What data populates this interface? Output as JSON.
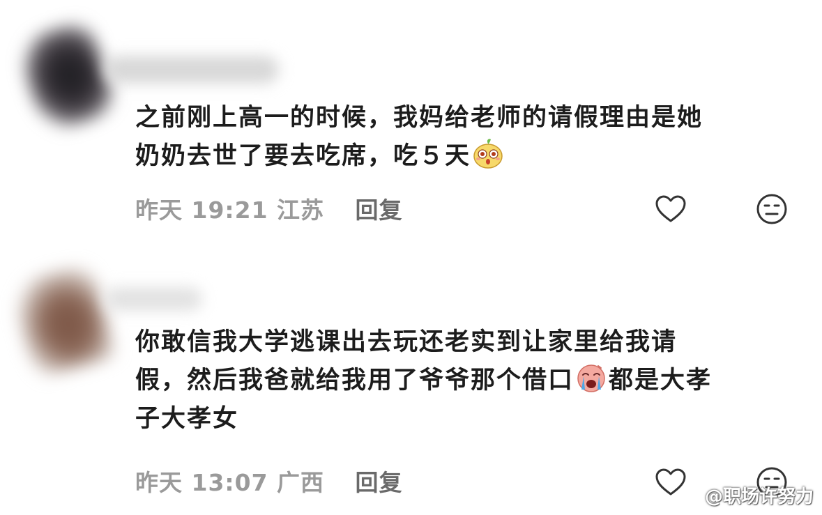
{
  "comments": [
    {
      "lines": [
        "之前刚上高一的时候，我妈给老师的请假理由是她",
        "奶奶去世了要去吃席，吃５天"
      ],
      "emoji": "shocked-fruit-emoji",
      "time": "昨天 19:21",
      "location": "江苏",
      "reply_label": "回复"
    },
    {
      "lines": [
        "你敢信我大学逃课出去玩还老实到让家里给我请",
        "假，然后我爸就给我用了爷爷那个借口",
        "都是大孝",
        "子大孝女"
      ],
      "emoji": "crying-face-emoji",
      "time": "昨天 13:07",
      "location": "广西",
      "reply_label": "回复"
    }
  ],
  "icons": {
    "like": "heart-outline-icon",
    "dislike": "neutral-face-icon"
  },
  "colors": {
    "text": "#1c1c1c",
    "meta": "#9a9a9a",
    "reply": "#6a6a6a",
    "icon": "#333333"
  },
  "watermark": "@职场许努力"
}
